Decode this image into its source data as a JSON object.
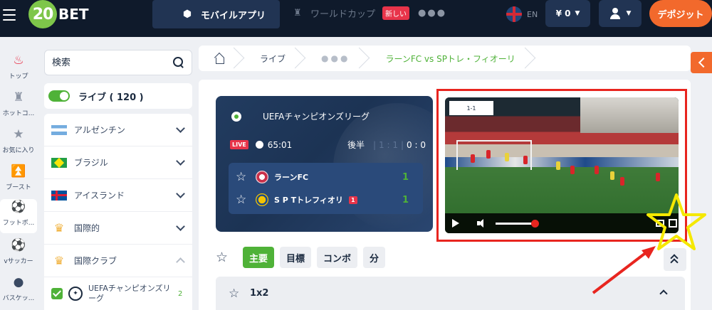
{
  "header": {
    "logo_text": "BET",
    "logo_number": "20",
    "mobile_app_label": "モバイルアプリ",
    "worldcup_label": "ワールドカップ",
    "new_badge": "新しい",
    "more_dots": "●●●",
    "language": "EN",
    "balance": "¥ 0",
    "deposit_label": "デポジット"
  },
  "rail": {
    "items": [
      {
        "label": "トップ",
        "icon": "flame-icon"
      },
      {
        "label": "ホットコ...",
        "icon": "trophy-icon"
      },
      {
        "label": "お気に入り",
        "icon": "star-icon"
      },
      {
        "label": "ブースト",
        "icon": "boost-icon"
      },
      {
        "label": "フットボ...",
        "icon": "football-icon"
      },
      {
        "label": "vサッカー",
        "icon": "virtual-soccer-icon"
      },
      {
        "label": "バスケッ...",
        "icon": "basketball-icon"
      }
    ]
  },
  "search": {
    "placeholder": "検索"
  },
  "live_filter": {
    "label": "ライブ ( 120 )"
  },
  "countries": [
    {
      "name": "アルゼンチン"
    },
    {
      "name": "ブラジル"
    },
    {
      "name": "アイスランド"
    },
    {
      "name": "国際的"
    },
    {
      "name": "国際クラブ"
    }
  ],
  "league": {
    "name": "UEFAチャンピオンズリーグ",
    "count": "2"
  },
  "breadcrumb": {
    "live": "ライブ",
    "dots": "●●●",
    "current": "ラーンFC vs SPトレ・フィオーリ"
  },
  "match": {
    "league": "UEFAチャンピオンズリーグ",
    "live_badge": "LIVE",
    "time": "65:01",
    "period": "後半",
    "half_score": "1 : 1",
    "total_score": "0 : 0",
    "home_team": "ラーンFC",
    "home_score": "1",
    "away_team": "S P Tトレフィオリ",
    "away_red_cards": "1",
    "away_score": "1"
  },
  "video": {
    "overlay_score": "1-1"
  },
  "market_tabs": [
    "主要",
    "目標",
    "コンボ",
    "分"
  ],
  "market": {
    "name": "1x2"
  },
  "colors": {
    "accent_green": "#4fb238",
    "brand_orange": "#f2692c",
    "live_red": "#e8344a",
    "highlight_red": "#e8251f",
    "navy": "#0f1a2b"
  }
}
